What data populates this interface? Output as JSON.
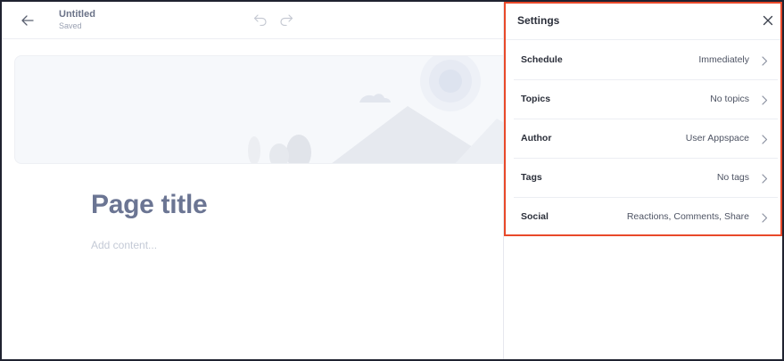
{
  "editor": {
    "doc_title": "Untitled",
    "doc_status": "Saved",
    "page_title": "Page title",
    "content_placeholder": "Add content..."
  },
  "settings": {
    "title": "Settings",
    "rows": [
      {
        "label": "Schedule",
        "value": "Immediately"
      },
      {
        "label": "Topics",
        "value": "No topics"
      },
      {
        "label": "Author",
        "value": "User Appspace"
      },
      {
        "label": "Tags",
        "value": "No tags"
      },
      {
        "label": "Social",
        "value": "Reactions, Comments, Share"
      }
    ]
  },
  "icons": {
    "back": "arrow-left-icon",
    "undo": "undo-icon",
    "redo": "redo-icon",
    "close": "close-icon",
    "chevron": "chevron-right-icon"
  },
  "colors": {
    "highlight": "#e8492a",
    "title_text": "#6b7593",
    "cover_bg": "#f6f8fb"
  }
}
